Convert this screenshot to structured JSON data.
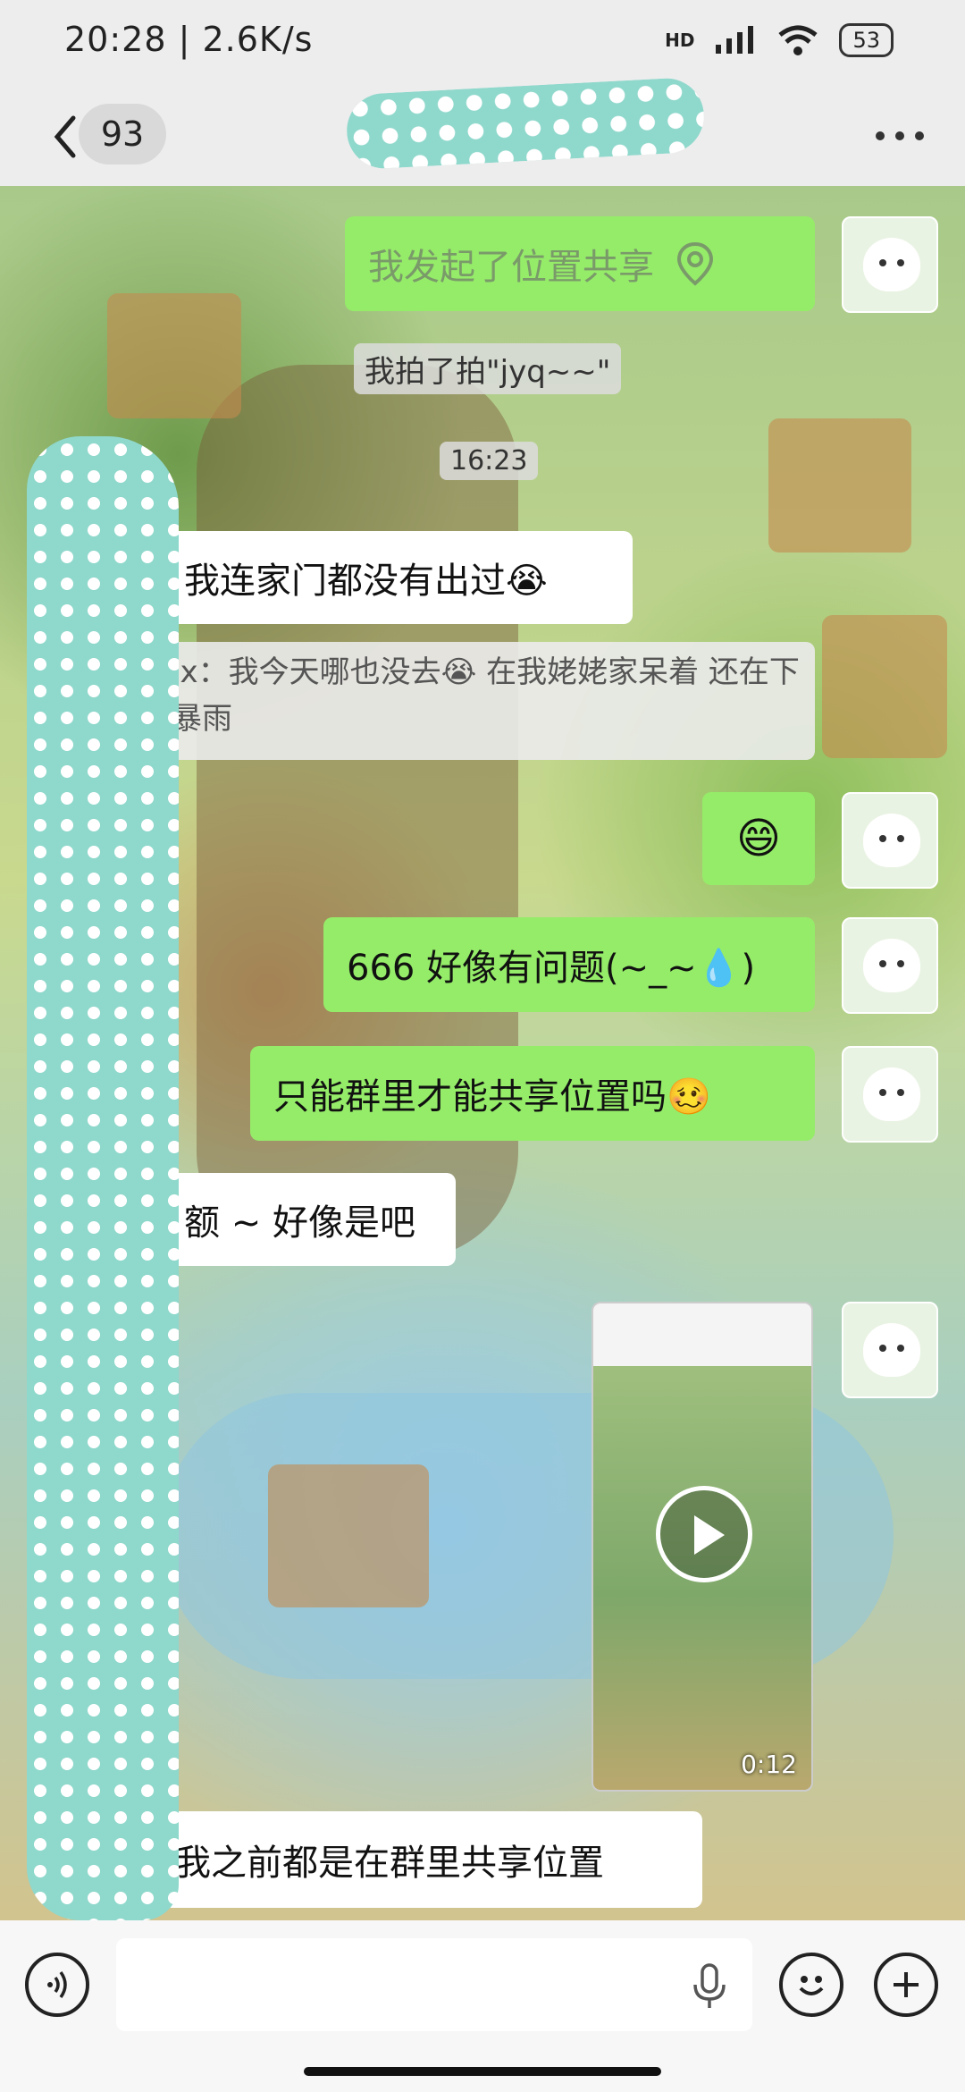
{
  "status_bar": {
    "time": "20:28 | 2.6K/s",
    "network": "HD",
    "battery": "53"
  },
  "header": {
    "back_count": "93"
  },
  "messages": [
    {
      "type": "sent",
      "text": "我发起了位置共享"
    },
    {
      "type": "system",
      "text": "我拍了拍\"jyq~~\""
    },
    {
      "type": "timestamp",
      "text": "16:23"
    },
    {
      "type": "received",
      "text": "我连家门都没有出过😭"
    },
    {
      "type": "quote",
      "text": "jx：我今天哪也没去😭 在我姥姥家呆着 还在下暴雨"
    },
    {
      "type": "sent",
      "text": "😄"
    },
    {
      "type": "sent",
      "text": "666 好像有问题(~_~💧)"
    },
    {
      "type": "sent",
      "text": "只能群里才能共享位置吗🥴"
    },
    {
      "type": "received",
      "text": "额 ~ 好像是吧"
    },
    {
      "type": "sent_video",
      "duration": "0:12"
    },
    {
      "type": "received",
      "text": "我之前都是在群里共享位置"
    }
  ],
  "icons": {
    "back": "chevron-left-icon",
    "more": "more-dots-icon",
    "location": "location-pin-icon",
    "voice": "voice-icon",
    "mic": "mic-icon",
    "emoji": "emoji-icon",
    "plus": "plus-icon"
  },
  "colors": {
    "sent_bubble": "#95ec69",
    "received_bubble": "#ffffff",
    "mask": "#8fd8cc"
  }
}
